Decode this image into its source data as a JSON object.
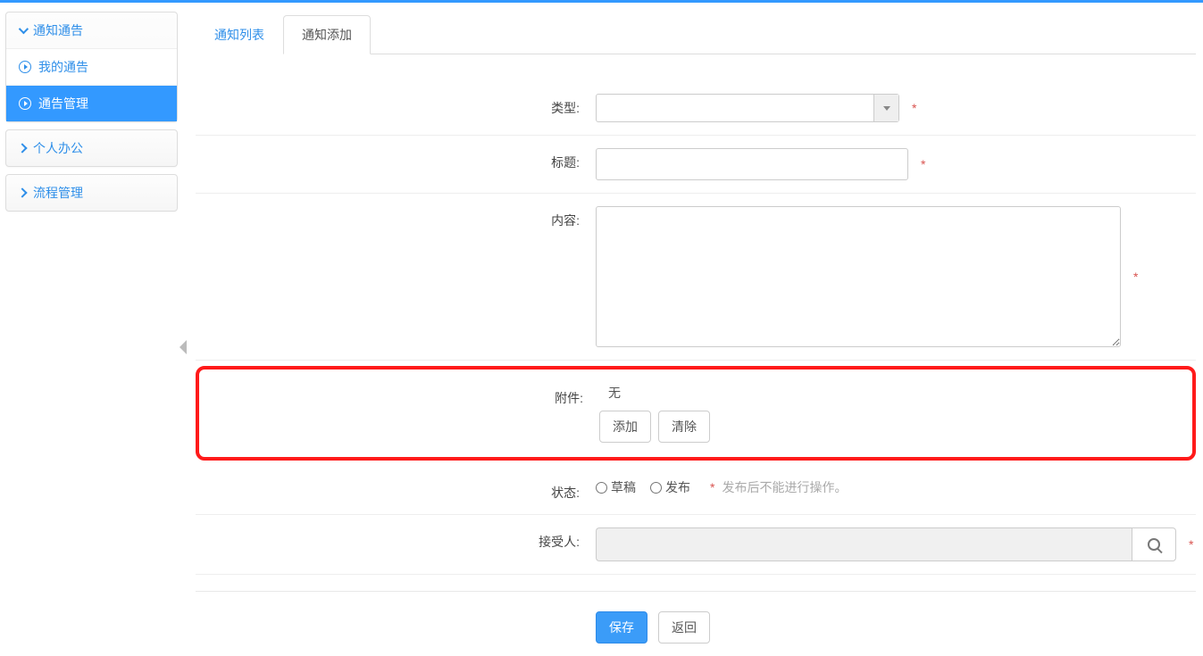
{
  "sidebar": {
    "section_label": "通知通告",
    "items": [
      {
        "label": "我的通告"
      },
      {
        "label": "通告管理"
      }
    ],
    "personal_label": "个人办公",
    "process_label": "流程管理"
  },
  "tabs": {
    "list_label": "通知列表",
    "add_label": "通知添加"
  },
  "form": {
    "type_label": "类型:",
    "title_label": "标题:",
    "content_label": "内容:",
    "attachment_label": "附件:",
    "attachment_value": "无",
    "add_btn": "添加",
    "clear_btn": "清除",
    "status_label": "状态:",
    "status_draft": "草稿",
    "status_publish": "发布",
    "status_hint": "发布后不能进行操作。",
    "recipient_label": "接受人:",
    "required_mark": "*"
  },
  "actions": {
    "save": "保存",
    "back": "返回"
  }
}
